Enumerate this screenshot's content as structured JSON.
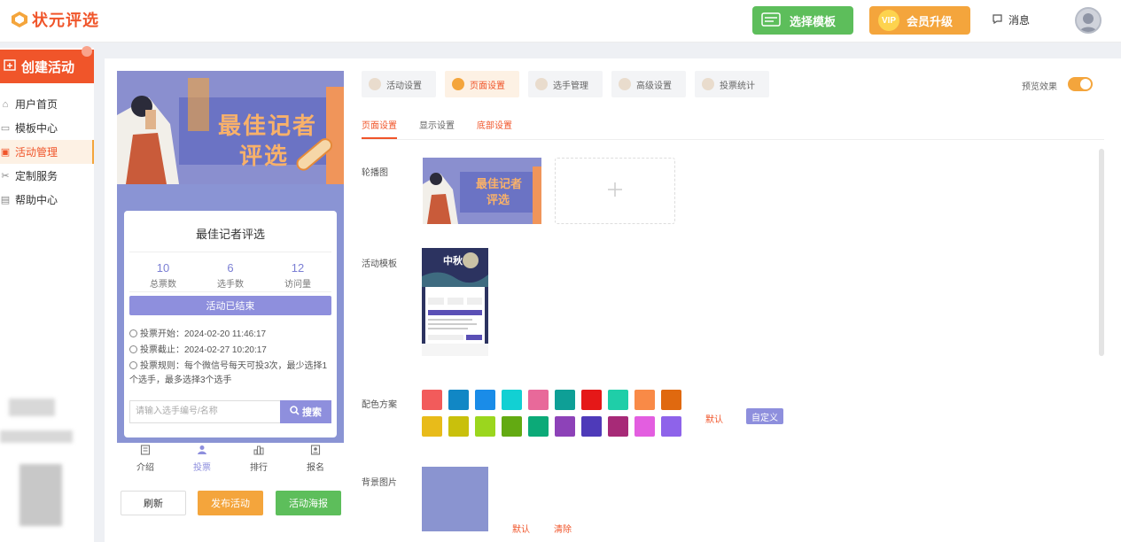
{
  "header": {
    "brand": "状元评选",
    "select_template": "选择模板",
    "vip_badge": "VIP",
    "vip_upgrade": "会员升级",
    "messages": "消息"
  },
  "sidebar": {
    "create": "创建活动",
    "items": [
      {
        "label": "用户首页",
        "icon": "home-icon"
      },
      {
        "label": "模板中心",
        "icon": "template-icon"
      },
      {
        "label": "活动管理",
        "icon": "activity-icon",
        "active": true
      },
      {
        "label": "定制服务",
        "icon": "service-icon"
      },
      {
        "label": "帮助中心",
        "icon": "help-icon"
      }
    ]
  },
  "preview": {
    "banner_line1": "最佳记者",
    "banner_line2": "评选",
    "title": "最佳记者评选",
    "stats": [
      {
        "num": "10",
        "label": "总票数"
      },
      {
        "num": "6",
        "label": "选手数"
      },
      {
        "num": "12",
        "label": "访问量"
      }
    ],
    "status": "活动已结束",
    "vote_start": "投票开始：2024-02-20 11:46:17",
    "vote_end": "投票截止：2024-02-27 10:20:17",
    "vote_rule": "投票规则：每个微信号每天可投3次，最少选择1个选手，最多选择3个选手",
    "search_placeholder": "请输入选手编号/名称",
    "search_button": "搜索",
    "tabs": [
      {
        "label": "介绍",
        "icon": "intro-icon"
      },
      {
        "label": "投票",
        "icon": "vote-icon",
        "active": true
      },
      {
        "label": "排行",
        "icon": "rank-icon"
      },
      {
        "label": "报名",
        "icon": "signup-icon"
      }
    ]
  },
  "actions": {
    "refresh": "刷新",
    "publish": "发布活动",
    "poster": "活动海报"
  },
  "settings": {
    "tabs": [
      {
        "label": "活动设置"
      },
      {
        "label": "页面设置",
        "active": true
      },
      {
        "label": "选手管理"
      },
      {
        "label": "高级设置"
      },
      {
        "label": "投票统计"
      }
    ],
    "preview_label": "预览效果",
    "subtabs": [
      {
        "label": "页面设置",
        "active": true
      },
      {
        "label": "显示设置"
      },
      {
        "label": "底部设置"
      }
    ],
    "carousel_label": "轮播图",
    "template_label": "活动模板",
    "template_thumb_title": "中秋",
    "color_label": "配色方案",
    "colors_row1": [
      "#f25b5b",
      "#1187c5",
      "#1a8ce8",
      "#12d0d3",
      "#e8699a",
      "#0e9f96",
      "#e51818",
      "#1fcea8",
      "#f98a47",
      "#e0690f"
    ],
    "colors_row2": [
      "#e8bb1a",
      "#c9c00c",
      "#9bd61e",
      "#63aa12",
      "#0caa78",
      "#8d42b8",
      "#4e3ab9",
      "#a72a77",
      "#e35ee0",
      "#8e63ea"
    ],
    "color_default": "默认",
    "color_custom": "自定义",
    "bg_label": "背景图片",
    "bg_default": "默认",
    "bg_clear": "清除"
  }
}
